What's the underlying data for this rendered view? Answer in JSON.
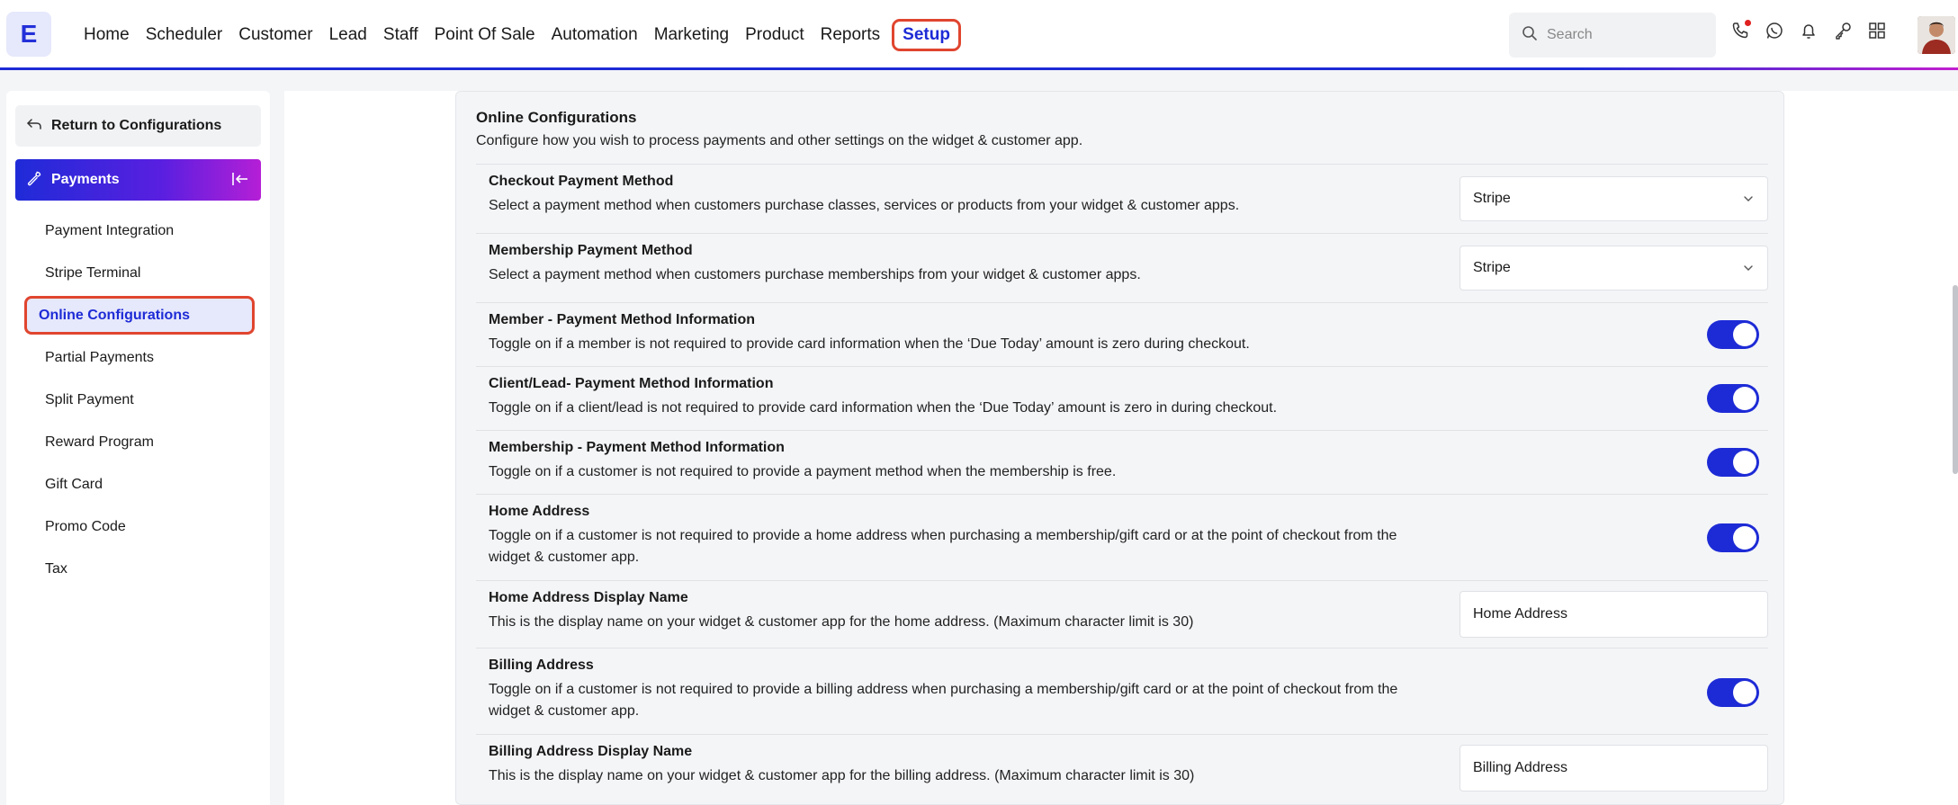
{
  "app": {
    "logo_letter": "E",
    "accent_color": "#1d2bd6",
    "highlight_color": "#e0452f"
  },
  "nav": {
    "items": [
      "Home",
      "Scheduler",
      "Customer",
      "Lead",
      "Staff",
      "Point Of Sale",
      "Automation",
      "Marketing",
      "Product",
      "Reports"
    ],
    "active": "Setup"
  },
  "search": {
    "placeholder": "Search"
  },
  "top_icons": [
    "phone-icon",
    "whatsapp-icon",
    "bell-icon",
    "key-icon",
    "apps-grid-icon"
  ],
  "sidebar": {
    "return_label": "Return to Configurations",
    "section_label": "Payments",
    "items": [
      "Payment Integration",
      "Stripe Terminal",
      "Online Configurations",
      "Partial Payments",
      "Split Payment",
      "Reward Program",
      "Gift Card",
      "Promo Code",
      "Tax"
    ],
    "active_item": "Online Configurations"
  },
  "content": {
    "title": "Online Configurations",
    "description": "Configure how you wish to process payments and other settings on the widget & customer app.",
    "rows": [
      {
        "title": "Checkout Payment Method",
        "desc": "Select a payment method when customers purchase classes, services or products from your widget & customer apps.",
        "control": "dropdown",
        "value": "Stripe"
      },
      {
        "title": "Membership Payment Method",
        "desc": "Select a payment method when customers purchase memberships from your widget & customer apps.",
        "control": "dropdown",
        "value": "Stripe"
      },
      {
        "title": "Member - Payment Method Information",
        "desc": "Toggle on if a member is not required to provide card information when the ‘Due Today’ amount is zero during checkout.",
        "control": "toggle",
        "value": "on"
      },
      {
        "title": "Client/Lead- Payment Method Information",
        "desc": "Toggle on if a client/lead is not required to provide card information when the ‘Due Today’ amount is zero in during checkout.",
        "control": "toggle",
        "value": "on"
      },
      {
        "title": "Membership - Payment Method Information",
        "desc": "Toggle on if a customer is not required to provide a payment method when the membership is free.",
        "control": "toggle",
        "value": "on"
      },
      {
        "title": "Home Address",
        "desc": "Toggle on if a customer is not required to provide a home address when purchasing a membership/gift card or at the point of checkout from the widget & customer app.",
        "control": "toggle",
        "value": "on"
      },
      {
        "title": "Home Address Display Name",
        "desc": "This is the display name on your widget & customer app for the home address. (Maximum character limit is 30)",
        "control": "text",
        "value": "Home Address"
      },
      {
        "title": "Billing Address",
        "desc": "Toggle on if a customer is not required to provide a billing address when purchasing a membership/gift card or at the point of checkout from the widget & customer app.",
        "control": "toggle",
        "value": "on"
      },
      {
        "title": "Billing Address Display Name",
        "desc": "This is the display name on your widget & customer app for the billing address. (Maximum character limit is 30)",
        "control": "text",
        "value": "Billing Address"
      }
    ]
  }
}
